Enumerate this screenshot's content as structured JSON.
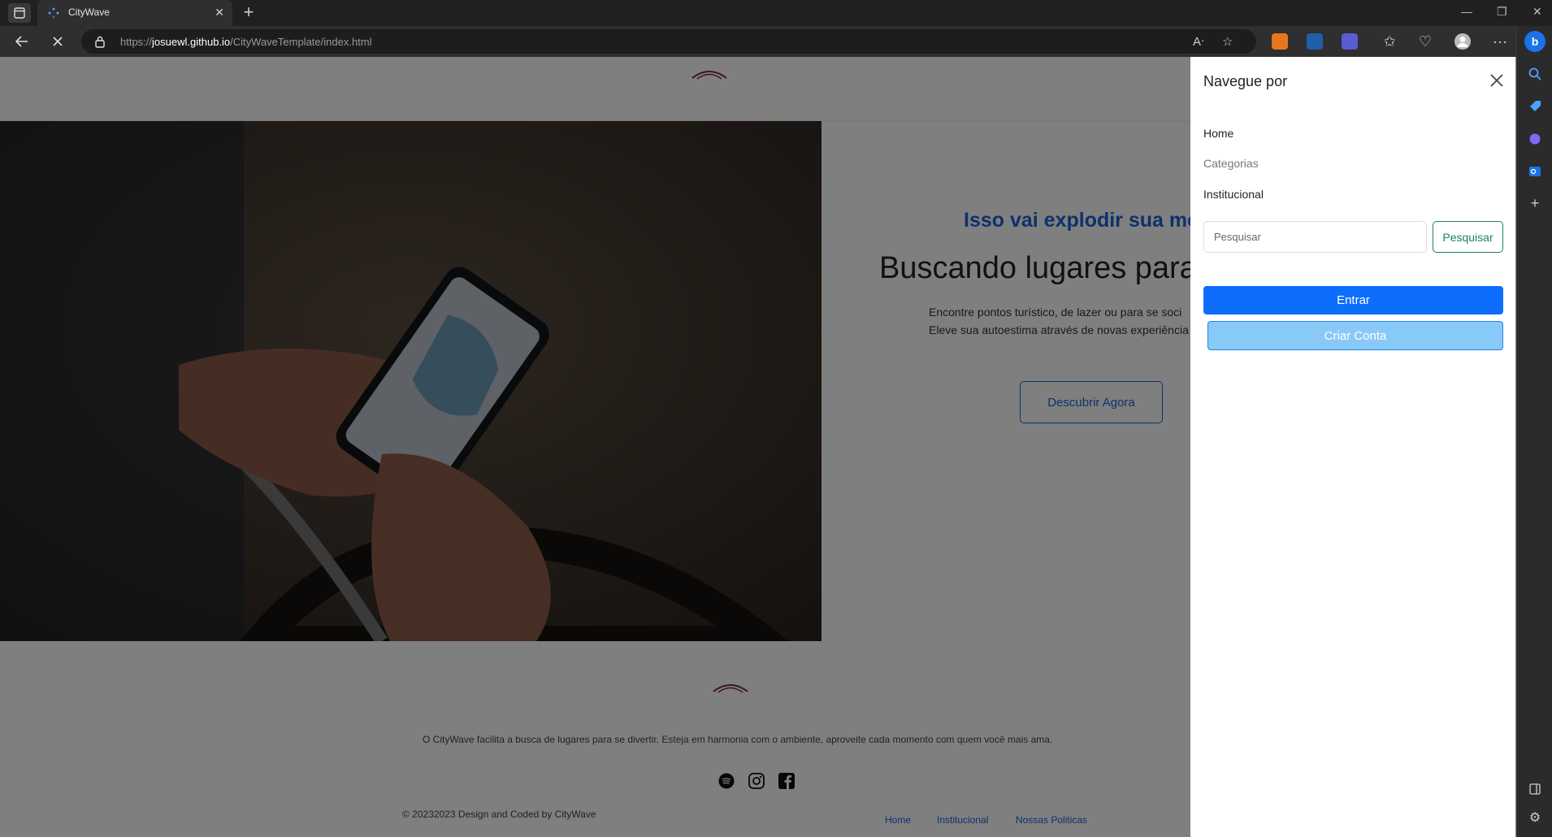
{
  "browser": {
    "tab_title": "CityWave",
    "url_prefix": "https://",
    "url_host": "josuewl.github.io",
    "url_path": "/CityWaveTemplate/index.html"
  },
  "hero": {
    "kicker": "Isso vai explodir sua me",
    "title": "Buscando lugares para se",
    "text_line1": "Encontre pontos turístico, de lazer ou para se soci",
    "text_line2": "Eleve sua autoestima através de novas experiência",
    "cta": "Descubrir Agora"
  },
  "footer": {
    "description": "O CityWave facilita a busca de lugares para se divertir. Esteja em harmonia com o ambiente, aproveite cada momento com quem você mais ama.",
    "copyright": "© 20232023 Design and Coded by CityWave",
    "links": [
      "Home",
      "Institucional",
      "Nossas Politicas"
    ],
    "social": [
      "spotify-icon",
      "instagram-icon",
      "facebook-icon"
    ]
  },
  "offcanvas": {
    "title": "Navegue por",
    "links": [
      "Home",
      "Categorias",
      "Institucional"
    ],
    "search_placeholder": "Pesquisar",
    "search_button": "Pesquisar",
    "login_button": "Entrar",
    "signup_button": "Criar Conta"
  },
  "colors": {
    "primary": "#0d6efd",
    "success": "#198754",
    "signup_bg": "#89c9f7",
    "kicker": "#1d63d8"
  }
}
